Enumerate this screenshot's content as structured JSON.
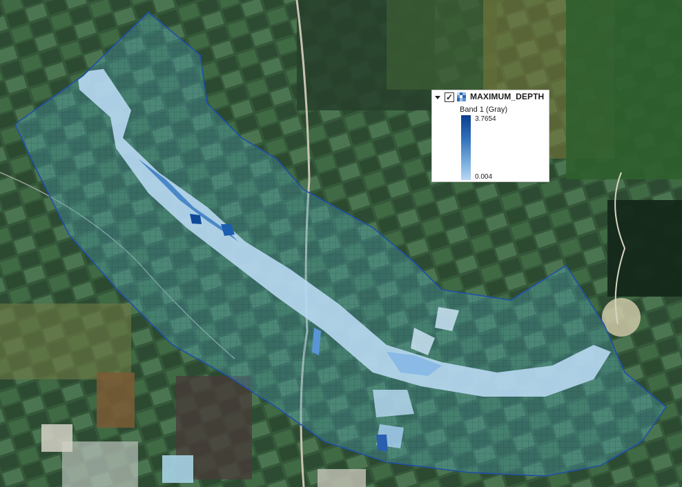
{
  "legend": {
    "layer_name": "MAXIMUM_DEPTH",
    "checkbox_mark": "✓",
    "band_label": "Band 1 (Gray)",
    "max_value": "3.7654",
    "min_value": "0.004"
  },
  "colors": {
    "polygon_outline": "#1f4fa8",
    "depth_high": "#0a3e8e",
    "depth_low": "#b8d8f4"
  }
}
